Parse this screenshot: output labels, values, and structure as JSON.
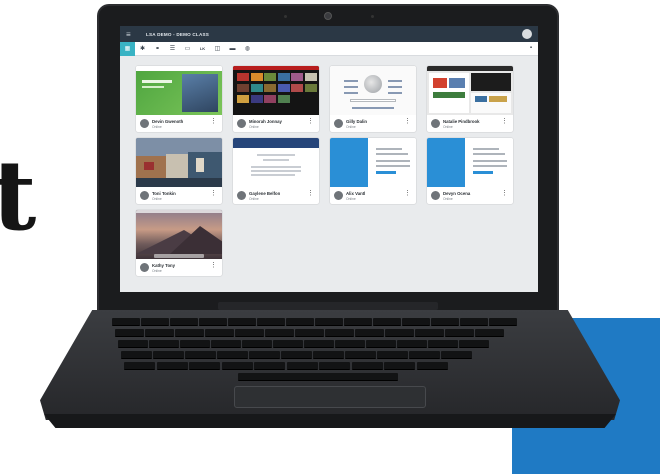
{
  "background": {
    "glyph": "t",
    "accent_color": "#1f7ac4"
  },
  "app": {
    "title": "LSA DEMO - DEMO CLASS",
    "menu_icon": "hamburger-icon",
    "topbar_color": "#2b3845",
    "accent": "#39b3c4"
  },
  "toolbar": {
    "items": [
      {
        "icon": "grid-icon",
        "label": "▦",
        "active": true
      },
      {
        "icon": "settings-icon",
        "label": "✱",
        "active": false
      },
      {
        "icon": "group-icon",
        "label": "⚭",
        "active": false
      },
      {
        "icon": "list-icon",
        "label": "☰",
        "active": false
      },
      {
        "icon": "lock-icon",
        "label": "▭",
        "active": false
      },
      {
        "icon": "text-icon",
        "label": "LK",
        "active": false,
        "text": true
      },
      {
        "icon": "window-icon",
        "label": "◫",
        "active": false
      },
      {
        "icon": "screen-icon",
        "label": "▬",
        "active": false
      },
      {
        "icon": "globe-icon",
        "label": "◍",
        "active": false
      }
    ],
    "chat_icon": "chat-icon"
  },
  "students": [
    {
      "name": "Devin Gwenoth",
      "status": "Online",
      "initial": "D",
      "thumb": "green"
    },
    {
      "name": "Minorah Jonnay",
      "status": "Online",
      "initial": "M",
      "thumb": "dark"
    },
    {
      "name": "Gilly Dalin",
      "status": "Online",
      "initial": "G",
      "thumb": "wiki"
    },
    {
      "name": "Natalie Pindbrook",
      "status": "Online",
      "initial": "N",
      "thumb": "multi"
    },
    {
      "name": "Toni Tonkin",
      "status": "Online",
      "initial": "T",
      "thumb": "photo"
    },
    {
      "name": "Gaylene Belfon",
      "status": "Online",
      "initial": "G",
      "thumb": "docs"
    },
    {
      "name": "Alix Vantl",
      "status": "Online",
      "initial": "A",
      "thumb": "login"
    },
    {
      "name": "Devyn Ocena",
      "status": "Online",
      "initial": "D",
      "thumb": "login"
    },
    {
      "name": "Kathy Tony",
      "status": "Online",
      "initial": "K",
      "thumb": "sierra"
    }
  ]
}
